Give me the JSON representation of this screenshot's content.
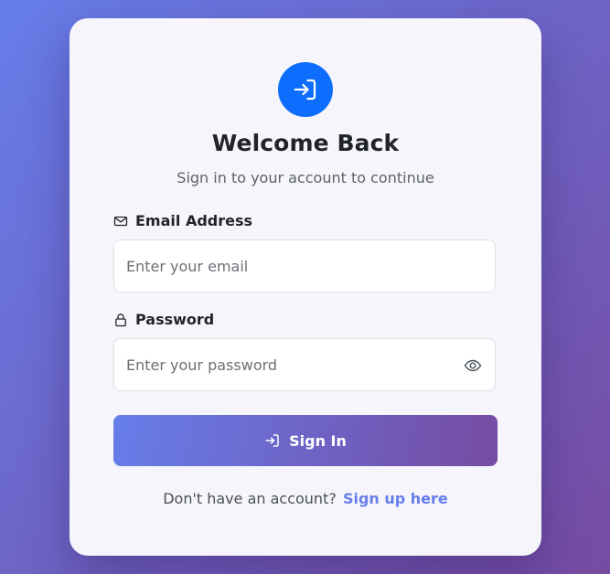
{
  "app": {
    "title": "Welcome Back",
    "subtitle": "Sign in to your account to continue",
    "logo_icon": "sign-in-icon"
  },
  "form": {
    "email": {
      "label": "Email Address",
      "icon": "envelope-icon",
      "placeholder": "Enter your email",
      "value": ""
    },
    "password": {
      "label": "Password",
      "icon": "lock-icon",
      "placeholder": "Enter your password",
      "value": "",
      "toggle_icon": "eye-icon"
    },
    "submit": {
      "label": "Sign In",
      "icon": "sign-in-icon"
    }
  },
  "footer": {
    "prompt": "Don't have an account?",
    "link_label": "Sign up here"
  },
  "colors": {
    "background_start": "#667eea",
    "background_end": "#764ba2",
    "logo_bg": "#0d6efd",
    "link": "#667eea"
  }
}
